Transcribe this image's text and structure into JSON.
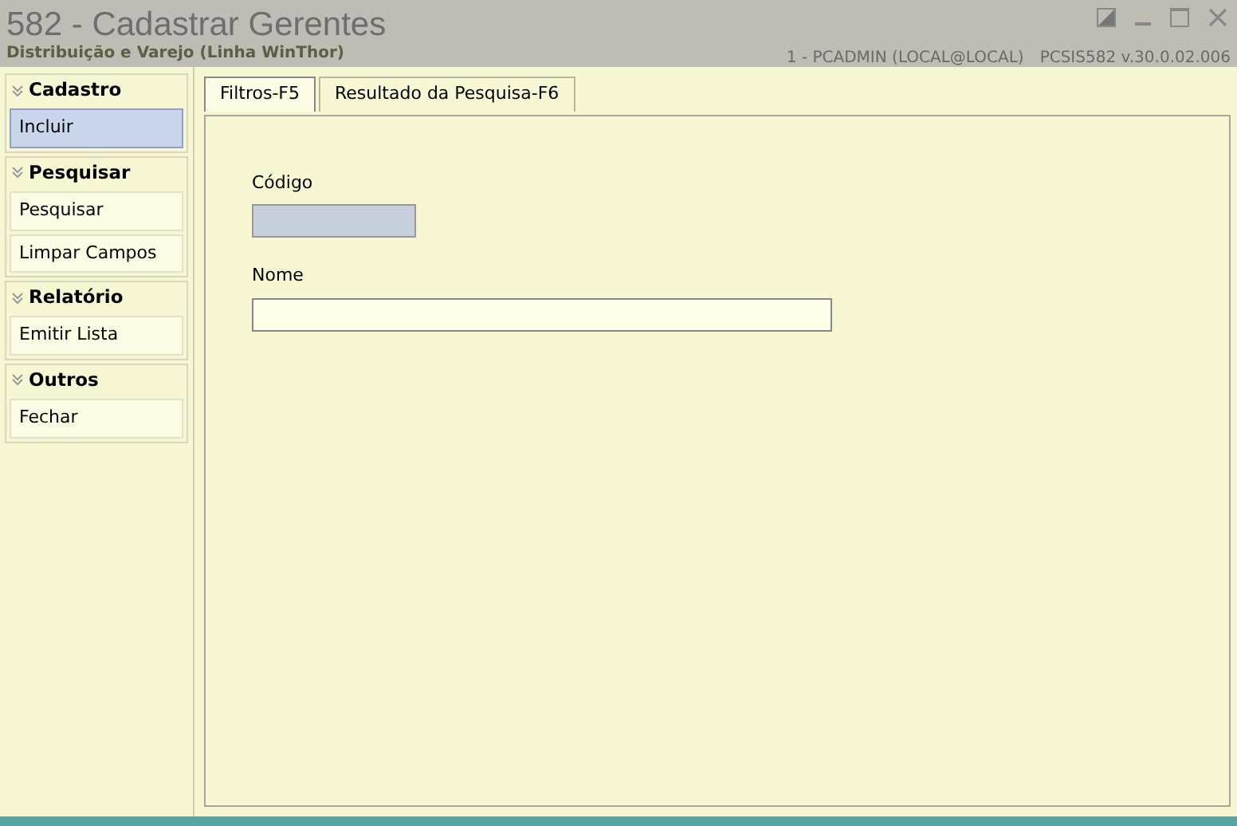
{
  "window": {
    "title": "582 - Cadastrar Gerentes",
    "subtitle": "Distribuição e Varejo (Linha WinThor)",
    "user_info": "1 - PCADMIN (LOCAL@LOCAL)",
    "version": "PCSIS582  v.30.0.02.006"
  },
  "sidebar": {
    "groups": [
      {
        "title": "Cadastro",
        "items": [
          {
            "label": "Incluir",
            "selected": true
          }
        ]
      },
      {
        "title": "Pesquisar",
        "items": [
          {
            "label": "Pesquisar",
            "selected": false
          },
          {
            "label": "Limpar Campos",
            "selected": false
          }
        ]
      },
      {
        "title": "Relatório",
        "items": [
          {
            "label": "Emitir Lista",
            "selected": false
          }
        ]
      },
      {
        "title": "Outros",
        "items": [
          {
            "label": "Fechar",
            "selected": false
          }
        ]
      }
    ]
  },
  "tabs": [
    {
      "label": "Filtros-F5",
      "selected": true
    },
    {
      "label": "Resultado da Pesquisa-F6",
      "selected": false
    }
  ],
  "fields": [
    {
      "label": "Código",
      "disabled": true,
      "wide": false
    },
    {
      "label": "Nome",
      "disabled": false,
      "wide": true
    }
  ]
}
